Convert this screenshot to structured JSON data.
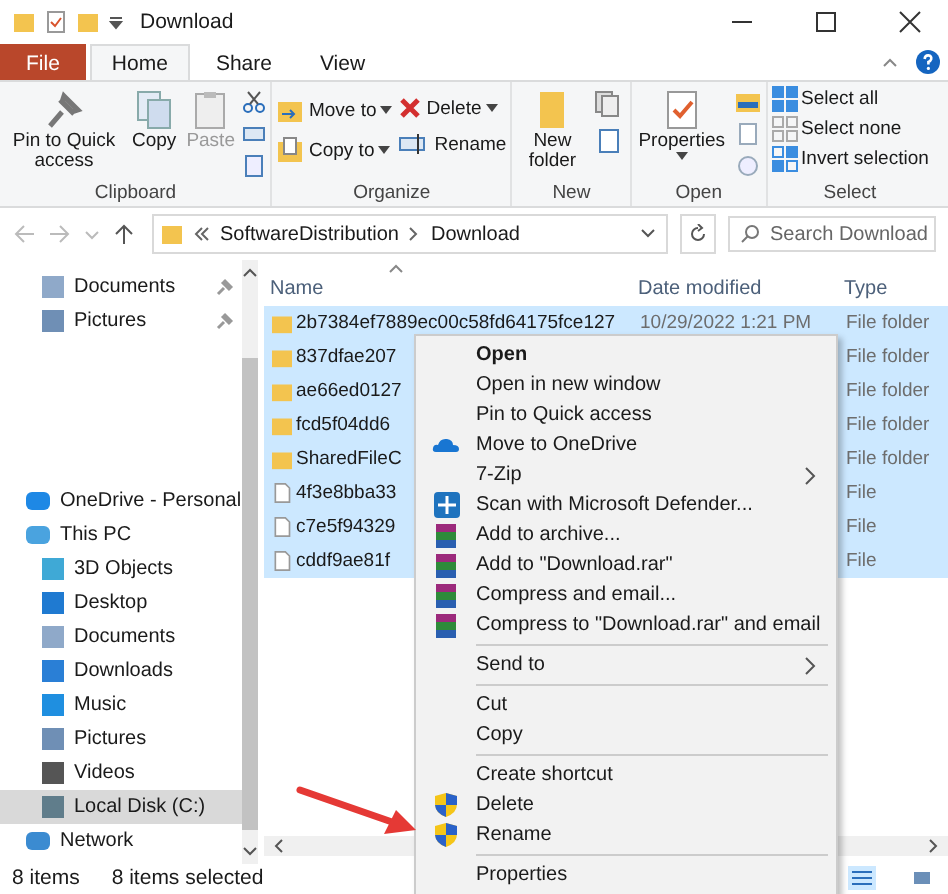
{
  "window": {
    "title": "Download"
  },
  "ribbon_tabs": [
    {
      "label": "File",
      "kind": "file",
      "selected": false
    },
    {
      "label": "Home",
      "kind": "tab",
      "selected": true
    },
    {
      "label": "Share",
      "kind": "tab",
      "selected": false
    },
    {
      "label": "View",
      "kind": "tab",
      "selected": false
    }
  ],
  "ribbon": {
    "clipboard": {
      "label": "Clipboard",
      "pin": "Pin to Quick access",
      "copy": "Copy",
      "paste": "Paste"
    },
    "organize": {
      "label": "Organize",
      "move_to": "Move to",
      "copy_to": "Copy to",
      "delete": "Delete",
      "rename": "Rename"
    },
    "new": {
      "label": "New",
      "new_folder": "New folder"
    },
    "open": {
      "label": "Open",
      "properties": "Properties"
    },
    "select": {
      "label": "Select",
      "select_all": "Select all",
      "select_none": "Select none",
      "invert": "Invert selection"
    }
  },
  "address": {
    "path": [
      "SoftwareDistribution",
      "Download"
    ],
    "search": {
      "placeholder": "Search Download"
    }
  },
  "quick_access": [
    {
      "label": "Documents",
      "kind": "documents",
      "pinned": true
    },
    {
      "label": "Pictures",
      "kind": "pictures",
      "pinned": true
    }
  ],
  "tree": [
    {
      "label": "OneDrive - Personal",
      "kind": "onedrive",
      "selected": false
    },
    {
      "label": "This PC",
      "kind": "pc",
      "selected": false,
      "children": [
        {
          "label": "3D Objects",
          "kind": "objects",
          "selected": false
        },
        {
          "label": "Desktop",
          "kind": "desktop",
          "selected": false
        },
        {
          "label": "Documents",
          "kind": "documents",
          "selected": false
        },
        {
          "label": "Downloads",
          "kind": "downloads",
          "selected": false
        },
        {
          "label": "Music",
          "kind": "music",
          "selected": false
        },
        {
          "label": "Pictures",
          "kind": "pictures",
          "selected": false
        },
        {
          "label": "Videos",
          "kind": "videos",
          "selected": false
        },
        {
          "label": "Local Disk (C:)",
          "kind": "disk",
          "selected": true
        }
      ]
    },
    {
      "label": "Network",
      "kind": "network",
      "selected": false
    }
  ],
  "table": {
    "columns": [
      "Name",
      "Date modified",
      "Type"
    ],
    "rows": [
      {
        "name": "2b7384ef7889ec00c58fd64175fce127",
        "date": "10/29/2022 1:21 PM",
        "type": "File folder",
        "kind": "folder",
        "selected": true
      },
      {
        "name": "837dfae207",
        "type": "File folder",
        "kind": "folder",
        "selected": true
      },
      {
        "name": "ae66ed0127",
        "type": "File folder",
        "kind": "folder",
        "selected": true
      },
      {
        "name": "fcd5f04dd6",
        "type": "File folder",
        "kind": "folder",
        "selected": true
      },
      {
        "name": "SharedFileC",
        "type": "File folder",
        "kind": "folder",
        "selected": true
      },
      {
        "name": "4f3e8bba33",
        "type": "File",
        "kind": "file",
        "selected": true
      },
      {
        "name": "c7e5f94329",
        "type": "File",
        "kind": "file",
        "selected": true
      },
      {
        "name": "cddf9ae81f",
        "type": "File",
        "kind": "file",
        "selected": true
      }
    ]
  },
  "context_menu": [
    {
      "label": "Open",
      "kind": "plain",
      "default": true
    },
    {
      "label": "Open in new window",
      "kind": "plain",
      "default": false
    },
    {
      "label": "Pin to Quick access",
      "kind": "plain",
      "default": false
    },
    {
      "label": "Move to OneDrive",
      "kind": "cloud",
      "default": false
    },
    {
      "label": "7-Zip",
      "kind": "submenu",
      "default": false
    },
    {
      "label": "Scan with Microsoft Defender...",
      "kind": "defender",
      "default": false
    },
    {
      "label": "Add to archive...",
      "kind": "archive",
      "default": false
    },
    {
      "label": "Add to \"Download.rar\"",
      "kind": "archive",
      "default": false
    },
    {
      "label": "Compress and email...",
      "kind": "archive",
      "default": false
    },
    {
      "label": "Compress to \"Download.rar\" and email",
      "kind": "archive",
      "default": false
    },
    {
      "kind": "separator"
    },
    {
      "label": "Send to",
      "kind": "submenu",
      "default": false
    },
    {
      "kind": "separator"
    },
    {
      "label": "Cut",
      "kind": "plain",
      "default": false
    },
    {
      "label": "Copy",
      "kind": "plain",
      "default": false
    },
    {
      "kind": "separator"
    },
    {
      "label": "Create shortcut",
      "kind": "plain",
      "default": false
    },
    {
      "label": "Delete",
      "kind": "shield",
      "default": false
    },
    {
      "label": "Rename",
      "kind": "shield",
      "default": false
    },
    {
      "kind": "separator"
    },
    {
      "label": "Properties",
      "kind": "plain",
      "default": false
    }
  ],
  "status_bar": {
    "count": "8 items",
    "selection": "8 items selected"
  }
}
